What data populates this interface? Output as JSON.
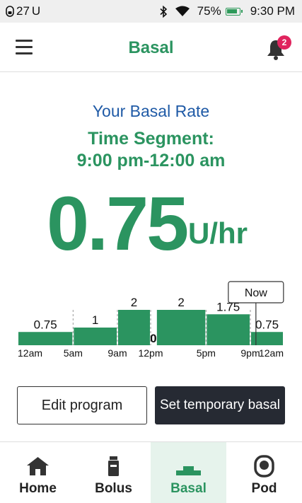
{
  "status_bar": {
    "insulin": "27",
    "insulin_unit": "U",
    "battery_percent": "75%",
    "time": "9:30 PM"
  },
  "header": {
    "title": "Basal",
    "notification_count": "2"
  },
  "basal": {
    "label": "Your Basal Rate",
    "segment_title": "Time Segment:",
    "segment_range": "9:00 pm-12:00 am",
    "rate": "0.75",
    "unit": "U/hr"
  },
  "chart_data": {
    "type": "bar",
    "segments": [
      {
        "start": 0,
        "end": 5,
        "value": 0.75,
        "label": "0.75"
      },
      {
        "start": 5,
        "end": 9,
        "value": 1,
        "label": "1"
      },
      {
        "start": 9,
        "end": 12,
        "value": 2,
        "label": "2"
      },
      {
        "start": 12,
        "end": 12.5,
        "value": 0,
        "label": "0"
      },
      {
        "start": 12.5,
        "end": 17,
        "value": 2,
        "label": "2"
      },
      {
        "start": 17,
        "end": 21,
        "value": 1.75,
        "label": "1.75"
      },
      {
        "start": 21,
        "end": 24,
        "value": 0.75,
        "label": "0.75"
      }
    ],
    "ticks": [
      {
        "hour": 0,
        "label": "12am"
      },
      {
        "hour": 5,
        "label": "5am"
      },
      {
        "hour": 9,
        "label": "9am"
      },
      {
        "hour": 12,
        "label": "12pm"
      },
      {
        "hour": 17,
        "label": "5pm"
      },
      {
        "hour": 21,
        "label": "9pm"
      },
      {
        "hour": 24,
        "label": "12am"
      }
    ],
    "now_hour": 21.5,
    "now_label": "Now",
    "bar_color": "#2b9460"
  },
  "actions": {
    "edit_label": "Edit program",
    "temp_label": "Set temporary basal"
  },
  "nav": {
    "items": [
      {
        "label": "Home",
        "icon": "home-icon"
      },
      {
        "label": "Bolus",
        "icon": "bolus-vial-icon"
      },
      {
        "label": "Basal",
        "icon": "basal-steps-icon"
      },
      {
        "label": "Pod",
        "icon": "pod-icon"
      }
    ],
    "active": "Basal"
  }
}
